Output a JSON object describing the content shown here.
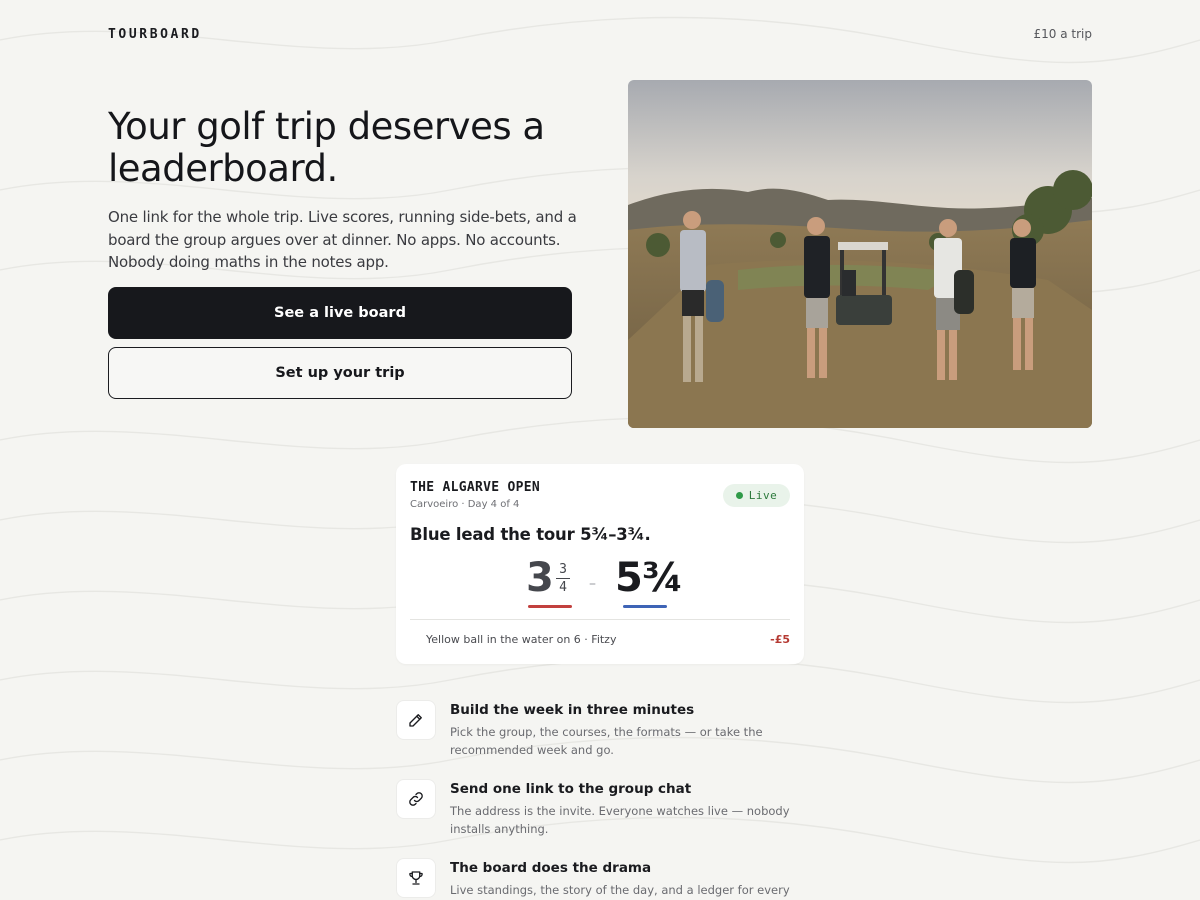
{
  "header": {
    "brand": "TOURBOARD",
    "price": "£10 a trip"
  },
  "hero": {
    "title": "Your golf trip deserves a leaderboard.",
    "description": "One link for the whole trip. Live scores, running side-bets, and a board the group argues over at dinner. No apps. No accounts. Nobody doing maths in the notes app.",
    "primary_cta": "See a live board",
    "secondary_cta": "Set up your trip"
  },
  "card": {
    "title": "THE ALGARVE OPEN",
    "subtitle": "Carvoeiro · Day 4 of 4",
    "status": "Live",
    "headline": "Blue lead the tour 5¾–3¾.",
    "score": {
      "left_whole": "3",
      "left_num": "3",
      "left_den": "4",
      "separator": "–",
      "right": "5¾"
    },
    "ledger": {
      "text": "Yellow ball in the water on 6 · Fitzy",
      "amount": "-£5"
    }
  },
  "features": [
    {
      "icon": "pencil-icon",
      "title": "Build the week in three minutes",
      "description": "Pick the group, the courses, the formats — or take the recommended week and go."
    },
    {
      "icon": "link-icon",
      "title": "Send one link to the group chat",
      "description": "The address is the invite. Everyone watches live — nobody installs anything."
    },
    {
      "icon": "trophy-icon",
      "title": "The board does the drama",
      "description": "Live standings, the story of the day, and a ledger for every"
    }
  ],
  "colors": {
    "team_red": "#c2403e",
    "team_blue": "#3e64b6",
    "live_green": "#2f9a48",
    "debit_red": "#b53a33"
  }
}
